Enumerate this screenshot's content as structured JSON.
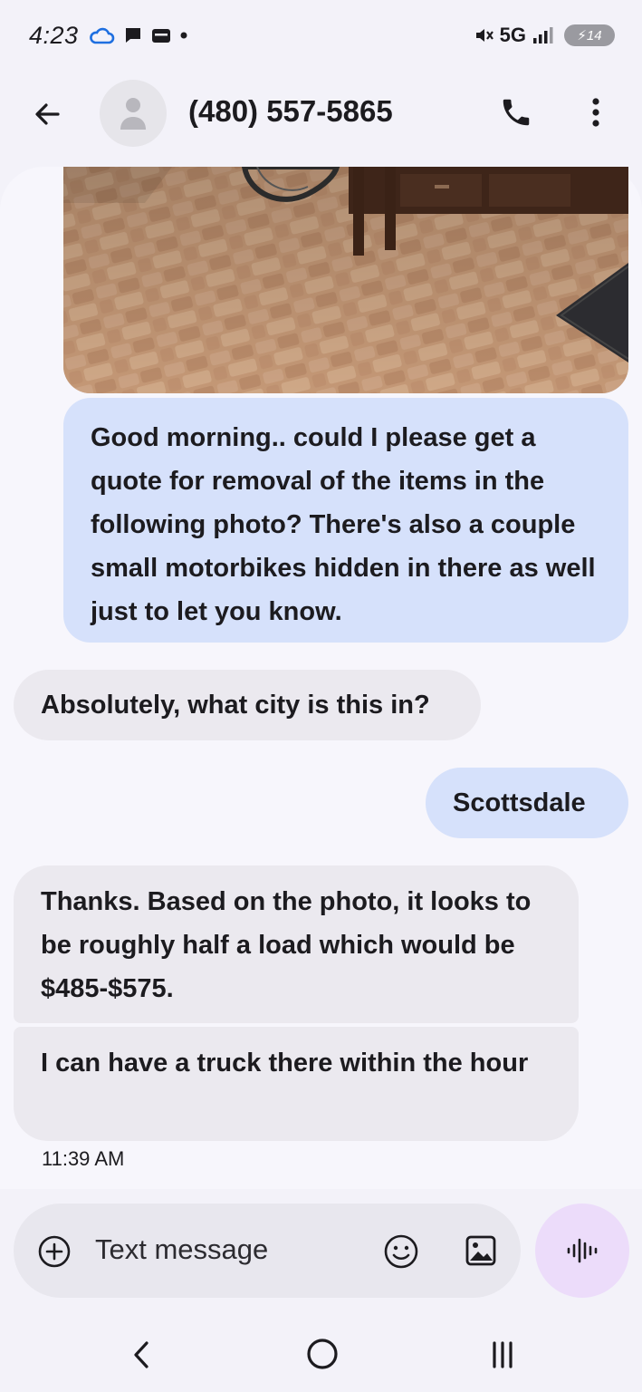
{
  "status_bar": {
    "time": "4:23",
    "network": "5G",
    "battery": "14"
  },
  "header": {
    "contact": "(480) 557-5865"
  },
  "messages": [
    {
      "direction": "outgoing",
      "text": "Good morning.. could I please get a quote for removal of the items in the following photo? There's also a couple small motorbikes hidden in there as well just to let you know."
    },
    {
      "direction": "incoming",
      "text": "Absolutely,  what city is this in?"
    },
    {
      "direction": "outgoing",
      "text": "Scottsdale"
    },
    {
      "direction": "incoming",
      "text": "Thanks. Based on the photo, it looks to be roughly half a load which would be $485-$575."
    },
    {
      "direction": "incoming",
      "text": "I can have a truck there within the hour"
    }
  ],
  "timestamp": "11:39 AM",
  "compose": {
    "placeholder": "Text message"
  },
  "icons": {
    "back": "arrow-left-icon",
    "call": "phone-icon",
    "more": "more-vert-icon",
    "add": "add-circle-icon",
    "emoji": "emoji-icon",
    "gallery": "gallery-icon",
    "voice": "voice-icon"
  },
  "colors": {
    "outgoing_bubble": "#d6e1fb",
    "incoming_bubble": "#ebe9ef",
    "voice_button": "#ecdcfa"
  }
}
